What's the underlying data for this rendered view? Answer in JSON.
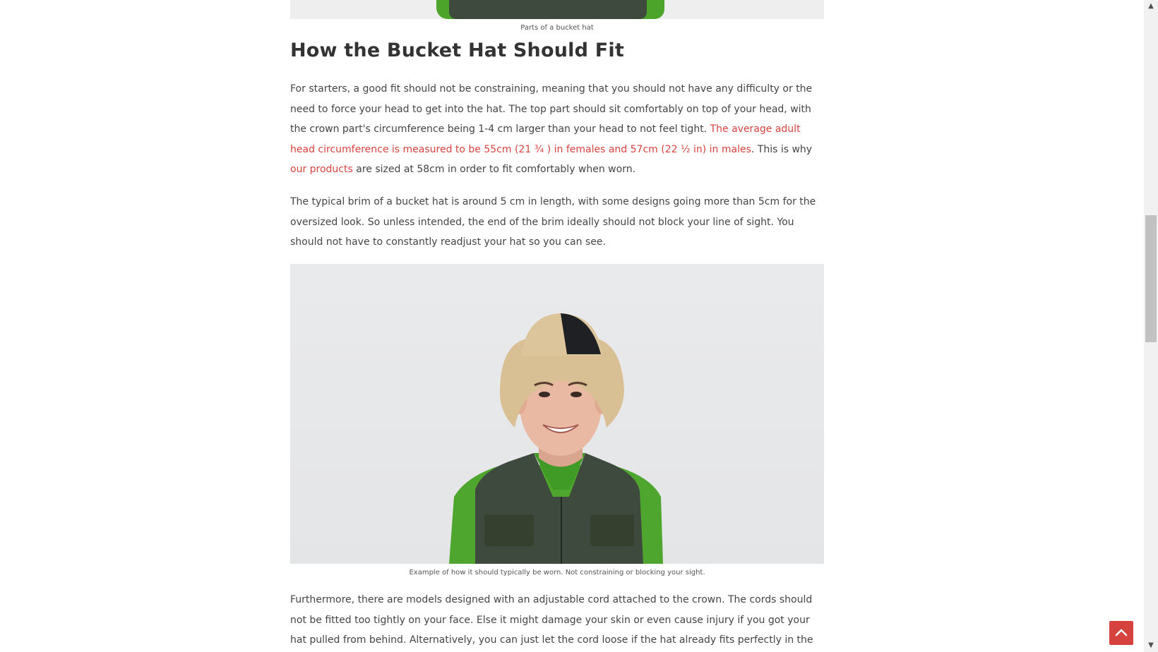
{
  "article": {
    "figure_top_caption": "Parts of a bucket hat",
    "heading": "How the Bucket Hat Should Fit",
    "paragraph1": {
      "text_a": "For starters, a good fit should not be constraining, meaning that you should not have any difficulty or the need to force your head to get into the hat. The top part should sit comfortably on top of your head, with the crown part's circumference being 1-4 cm larger than your head to not feel tight. ",
      "link_circumference": "The average adult head circumference is measured to be 55cm (21 ¾ ) in females and 57cm (22 ½ in) in males",
      "text_b": ". This is why ",
      "link_products": "our products",
      "text_c": " are sized at 58cm in order to fit comfortably when worn."
    },
    "paragraph2": "The typical brim of a bucket hat is around 5 cm in length, with some designs going more than 5cm for the oversized look. So unless intended, the end of the brim ideally should not block your line of sight. You should not have to constantly readjust your hat so you can see.",
    "photo_caption": "Example of how it should typically be worn. Not constraining or blocking your sight.",
    "paragraph3": "Furthermore, there are models designed with an adjustable cord attached to the crown. The cords should not be fitted too tightly on your face. Else it might damage your skin or even cause injury if you got your hat pulled from behind. Alternatively, you can just let the cord loose if the hat already fits perfectly in the first place."
  },
  "colors": {
    "link": "#d6433f",
    "back_to_top": "#d6433f",
    "heading": "#333333"
  },
  "icons": {
    "scroll_up": "chevron-up-icon",
    "scroll_down": "chevron-down-icon",
    "back_to_top": "chevron-up-icon"
  }
}
